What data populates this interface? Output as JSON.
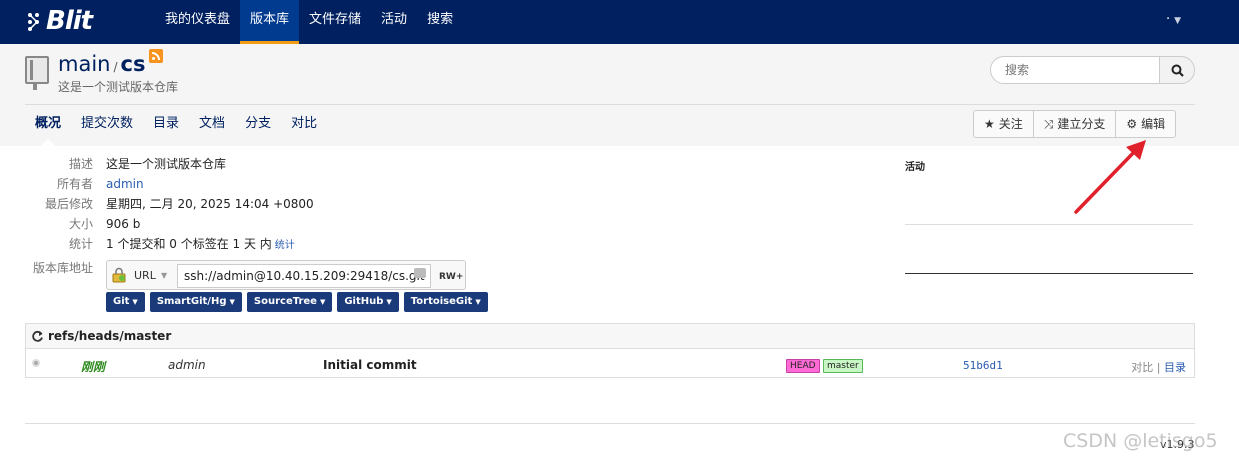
{
  "app": {
    "logo_text": "Blit"
  },
  "nav": {
    "items": [
      {
        "label": "我的仪表盘"
      },
      {
        "label": "版本库"
      },
      {
        "label": "文件存储"
      },
      {
        "label": "活动"
      },
      {
        "label": "搜索"
      }
    ],
    "active_index": 1,
    "user_menu": "·"
  },
  "repo": {
    "owner_path": "main",
    "name": "cs",
    "description": "这是一个测试版本仓库",
    "search_placeholder": "搜索"
  },
  "tabs": [
    {
      "label": "概况",
      "active": true
    },
    {
      "label": "提交次数"
    },
    {
      "label": "目录"
    },
    {
      "label": "文档"
    },
    {
      "label": "分支"
    },
    {
      "label": "对比"
    }
  ],
  "actions": {
    "watch": "关注",
    "fork": "建立分支",
    "edit": "编辑"
  },
  "summary": {
    "description_key": "描述",
    "description_val": "这是一个测试版本仓库",
    "owner_key": "所有者",
    "owner_val": "admin",
    "modified_key": "最后修改",
    "modified_val": "星期四, 二月 20, 2025 14:04 +0800",
    "size_key": "大小",
    "size_val": "906 b",
    "stats_key": "统计",
    "stats_val": "1 个提交和 0 个标签在 1 天 内",
    "stats_link": "统计",
    "url_key": "版本库地址",
    "url_label": "URL",
    "url_value": "ssh://admin@10.40.15.209:29418/cs.git",
    "url_access": "RW+"
  },
  "clients": [
    {
      "label": "Git"
    },
    {
      "label": "SmartGit/Hg"
    },
    {
      "label": "SourceTree"
    },
    {
      "label": "GitHub"
    },
    {
      "label": "TortoiseGit"
    }
  ],
  "activity": {
    "title": "活动"
  },
  "branch": {
    "ref": "refs/heads/master",
    "commit": {
      "when": "刚刚",
      "author": "admin",
      "message": "Initial commit",
      "refs": [
        "HEAD",
        "master"
      ],
      "sha": "51b6d1",
      "link_compare": "对比",
      "separator": "|",
      "link_tree": "目录"
    }
  },
  "footer": {
    "version": "v1.9.3"
  },
  "watermark": "CSDN @letisgo5",
  "colors": {
    "nav_bg": "#002060",
    "accent_orange": "#f39c12",
    "link_blue": "#2a5db0",
    "commit_green": "#2e8b1e",
    "head_badge": "#ff6ad5",
    "master_badge": "#c8f7c5",
    "annotation_red": "#e0202a"
  }
}
